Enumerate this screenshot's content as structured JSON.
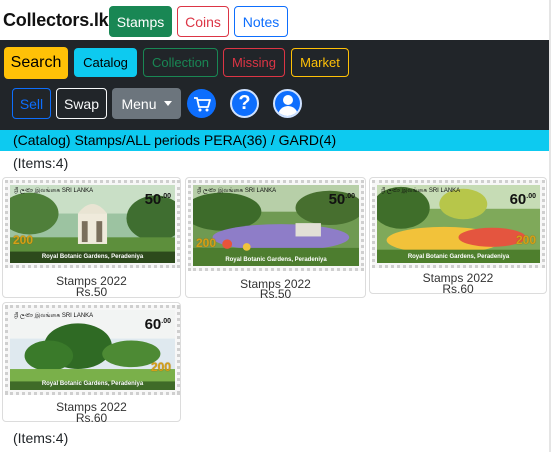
{
  "topbar": {
    "brand": "Collectors.lk",
    "tabs": [
      {
        "label": "Stamps",
        "active": true
      },
      {
        "label": "Coins",
        "active": false
      },
      {
        "label": "Notes",
        "active": false
      }
    ]
  },
  "navbar": {
    "search_label": "Search",
    "catalog_label": "Catalog",
    "collection_label": "Collection",
    "missing_label": "Missing",
    "market_label": "Market",
    "sell_label": "Sell",
    "swap_label": "Swap",
    "menu_label": "Menu",
    "icons": [
      "cart-icon",
      "help-icon",
      "user-avatar-icon"
    ],
    "help_glyph": "?"
  },
  "breadcrumb": "(Catalog) Stamps/ALL periods PERA(36) / GARD(4)",
  "items_count_label": "(Items:4)",
  "items": [
    {
      "title": "Stamps 2022",
      "price": "Rs.50",
      "stamp": {
        "country": "ශ්‍රී ලංකා இலங்கை SRI LANKA",
        "value": "50",
        "value_cents": ".00",
        "anniv": "200",
        "years": "1822-2022",
        "caption": "Royal Botanic Gardens, Peradeniya"
      }
    },
    {
      "title": "Stamps 2022",
      "price": "Rs.50",
      "stamp": {
        "country": "ශ්‍රී ලංකා இலங்கை SRI LANKA",
        "value": "50",
        "value_cents": ".00",
        "anniv": "200",
        "years": "1822-2022",
        "caption": "Royal Botanic Gardens, Peradeniya"
      }
    },
    {
      "title": "Stamps 2022",
      "price": "Rs.60",
      "stamp": {
        "country": "ශ්‍රී ලංකා இலங்கை SRI LANKA",
        "value": "60",
        "value_cents": ".00",
        "anniv": "200",
        "years": "1822-2022",
        "caption": "Royal Botanic Gardens, Peradeniya"
      }
    },
    {
      "title": "Stamps 2022",
      "price": "Rs.60",
      "stamp": {
        "country": "ශ්‍රී ලංකා இலங்கை SRI LANKA",
        "value": "60",
        "value_cents": ".00",
        "anniv": "200",
        "years": "1822-2022",
        "caption": "Royal Botanic Gardens, Peradeniya"
      }
    }
  ],
  "colors": {
    "success": "#198754",
    "danger": "#dc3545",
    "primary": "#0d6efd",
    "warning": "#ffc107",
    "info": "#0dcaf0",
    "dark": "#212529"
  }
}
